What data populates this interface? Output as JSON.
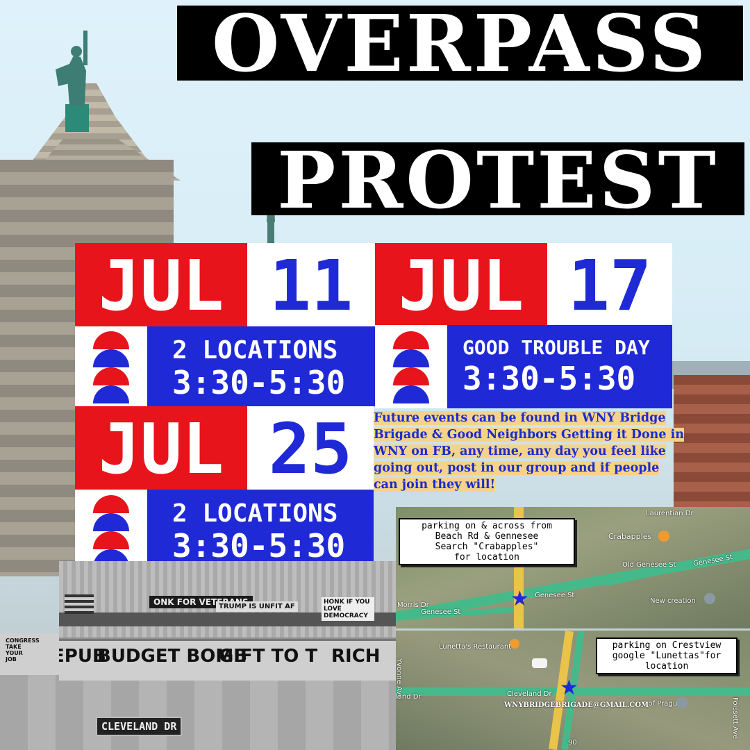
{
  "title": {
    "line1": "OVERPASS",
    "line2": "PROTEST"
  },
  "colors": {
    "red": "#e8141c",
    "blue": "#1f2ad6",
    "highlight": "#f6d38a"
  },
  "events": [
    {
      "month": "JUL",
      "day": "11",
      "line1": "2 LOCATIONS",
      "line2": "3:30-5:30"
    },
    {
      "month": "JUL",
      "day": "17",
      "line1": "GOOD TROUBLE DAY",
      "line2": "3:30-5:30"
    },
    {
      "month": "JUL",
      "day": "25",
      "line1": "2 LOCATIONS",
      "line2": "3:30-5:30"
    }
  ],
  "notice": "Future events can be found in WNY Bridge Brigade & Good Neighbors Getting it Done in WNY on FB, any time, any day you feel like going out, post in our group and if people can join they will!",
  "map1": {
    "callout": [
      "parking on & across from",
      "Beach Rd & Gennesee",
      "Search \"Crabapples\"",
      "for location"
    ],
    "labels": {
      "lauren": "Laurentian Dr",
      "crabapples": "Crabapples",
      "old": "Old Genesee St",
      "genesee_right": "Genesee St",
      "genesee_mid": "Genesee St",
      "genesee_left": "Genesee St",
      "morris": "Morris Dr",
      "newcreation": "New creation"
    }
  },
  "map2": {
    "callout": [
      "parking on Crestview",
      "google \"Lunettas\"for",
      "location"
    ],
    "labels": {
      "lunettas": "Lunetta's Restaurant",
      "yvonne": "Yvonne Ave",
      "cleveland": "Cleveland Dr",
      "cleveland_left": "land Dr",
      "prague": "nt of Prague",
      "foissett": "Foissett Ave",
      "route": "90"
    },
    "email": "WNYBRIDGEBRIGADE@GMAIL.COM"
  },
  "photo": {
    "sign": "CLEVELAND DR",
    "banner_upper": "ONK FOR VETERANS",
    "banner_trump": "TRUMP IS UNFIT AF",
    "banner_honk": "HONK IF YOU LOVE DEMOCRACY",
    "banner_lower": [
      "REPUB",
      "BUDGET BOMB",
      "GIFT TO T",
      "RICH"
    ],
    "banner_small": "CONGRESS TAKE YOUR JOB"
  }
}
